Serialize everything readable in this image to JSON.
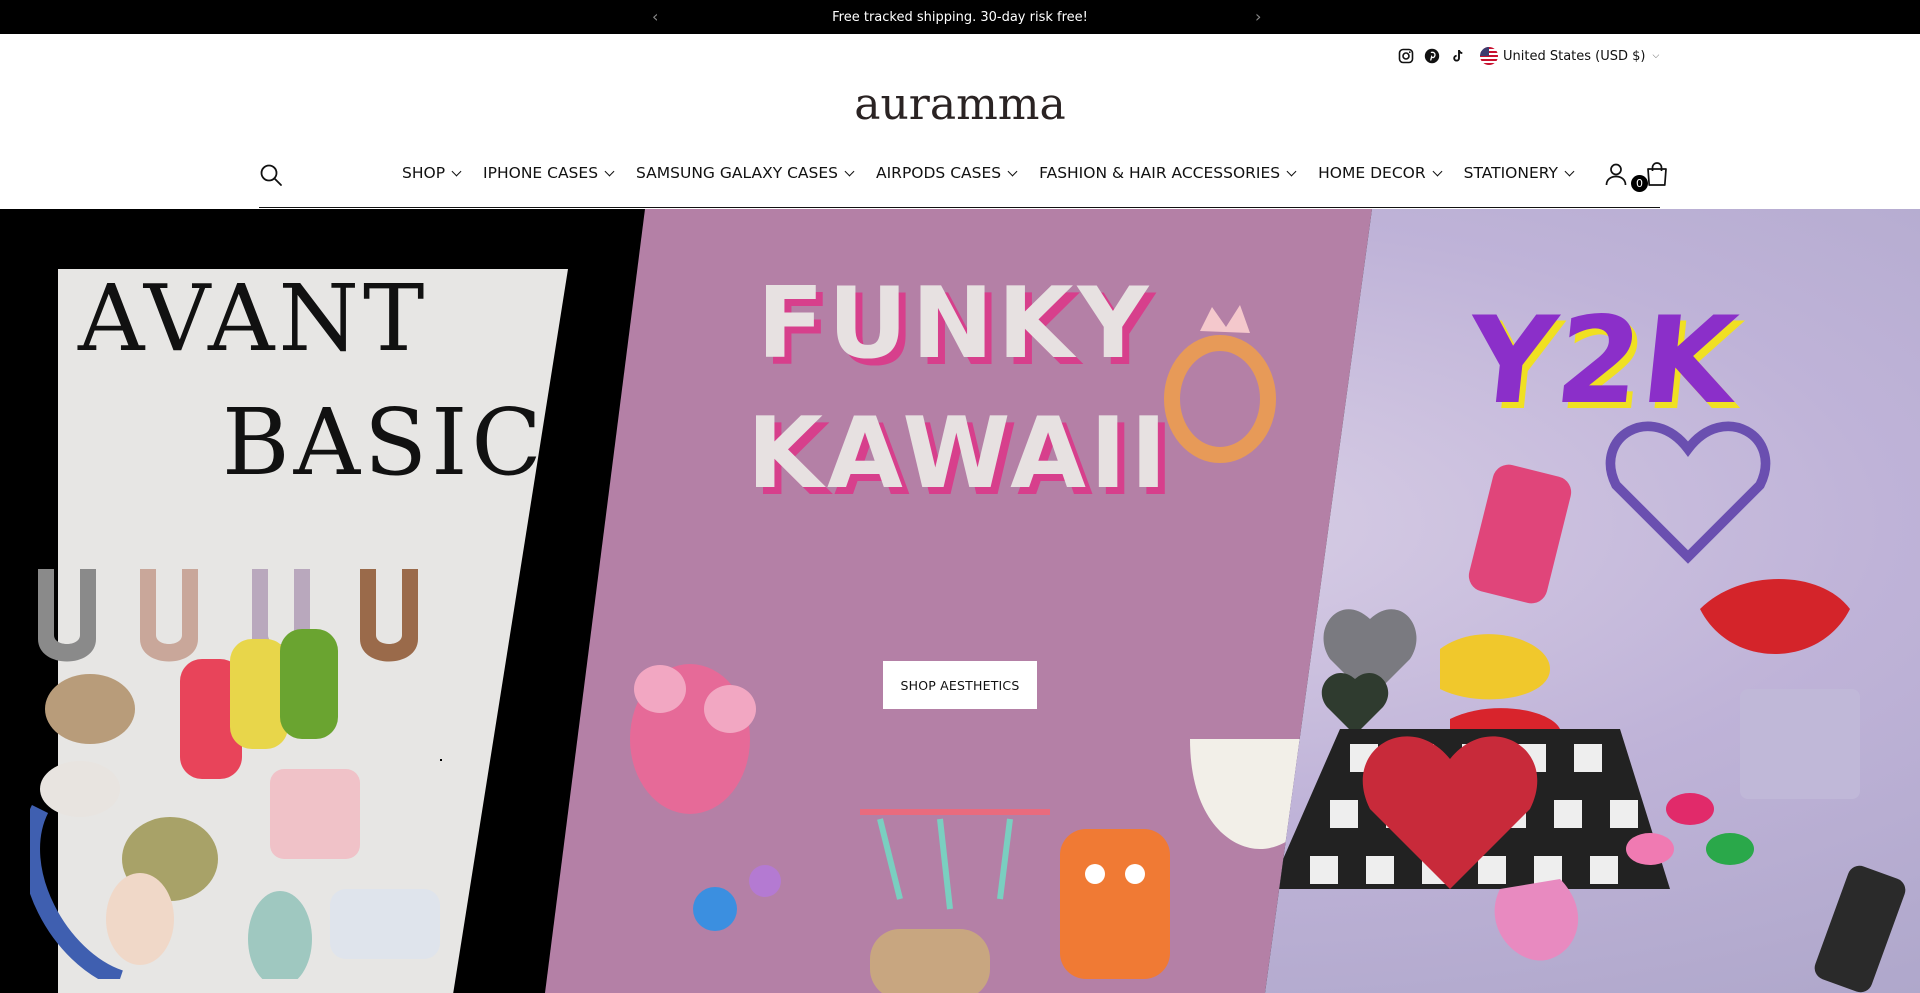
{
  "announcement": {
    "text": "Free tracked shipping. 30-day risk free!",
    "prev_icon": "chevron-left-icon",
    "next_icon": "chevron-right-icon"
  },
  "utility": {
    "social_icons": [
      "instagram-icon",
      "pinterest-icon",
      "tiktok-icon"
    ],
    "country_label": "United States (USD $)"
  },
  "header": {
    "logo": "auramma",
    "cart_count": "0",
    "icons": [
      "search-icon",
      "account-icon",
      "cart-icon"
    ]
  },
  "nav": {
    "items": [
      {
        "label": "SHOP"
      },
      {
        "label": "IPHONE CASES"
      },
      {
        "label": "SAMSUNG GALAXY CASES"
      },
      {
        "label": "AIRPODS CASES"
      },
      {
        "label": "FASHION & HAIR ACCESSORIES"
      },
      {
        "label": "HOME DECOR"
      },
      {
        "label": "STATIONERY"
      }
    ]
  },
  "hero": {
    "left_title_line1": "AVANT",
    "left_title_line2": "BASIC",
    "mid_title_line1": "FUNKY",
    "mid_title_line2": "KAWAII",
    "right_title": "Y2K",
    "cta_label": "SHOP AESTHETICS",
    "colors": {
      "mid_panel": "#b480a6",
      "y2k_purple": "#8b2fc9",
      "y2k_yellow": "#f0e022",
      "kawaii_pink": "#d73f8c"
    }
  }
}
